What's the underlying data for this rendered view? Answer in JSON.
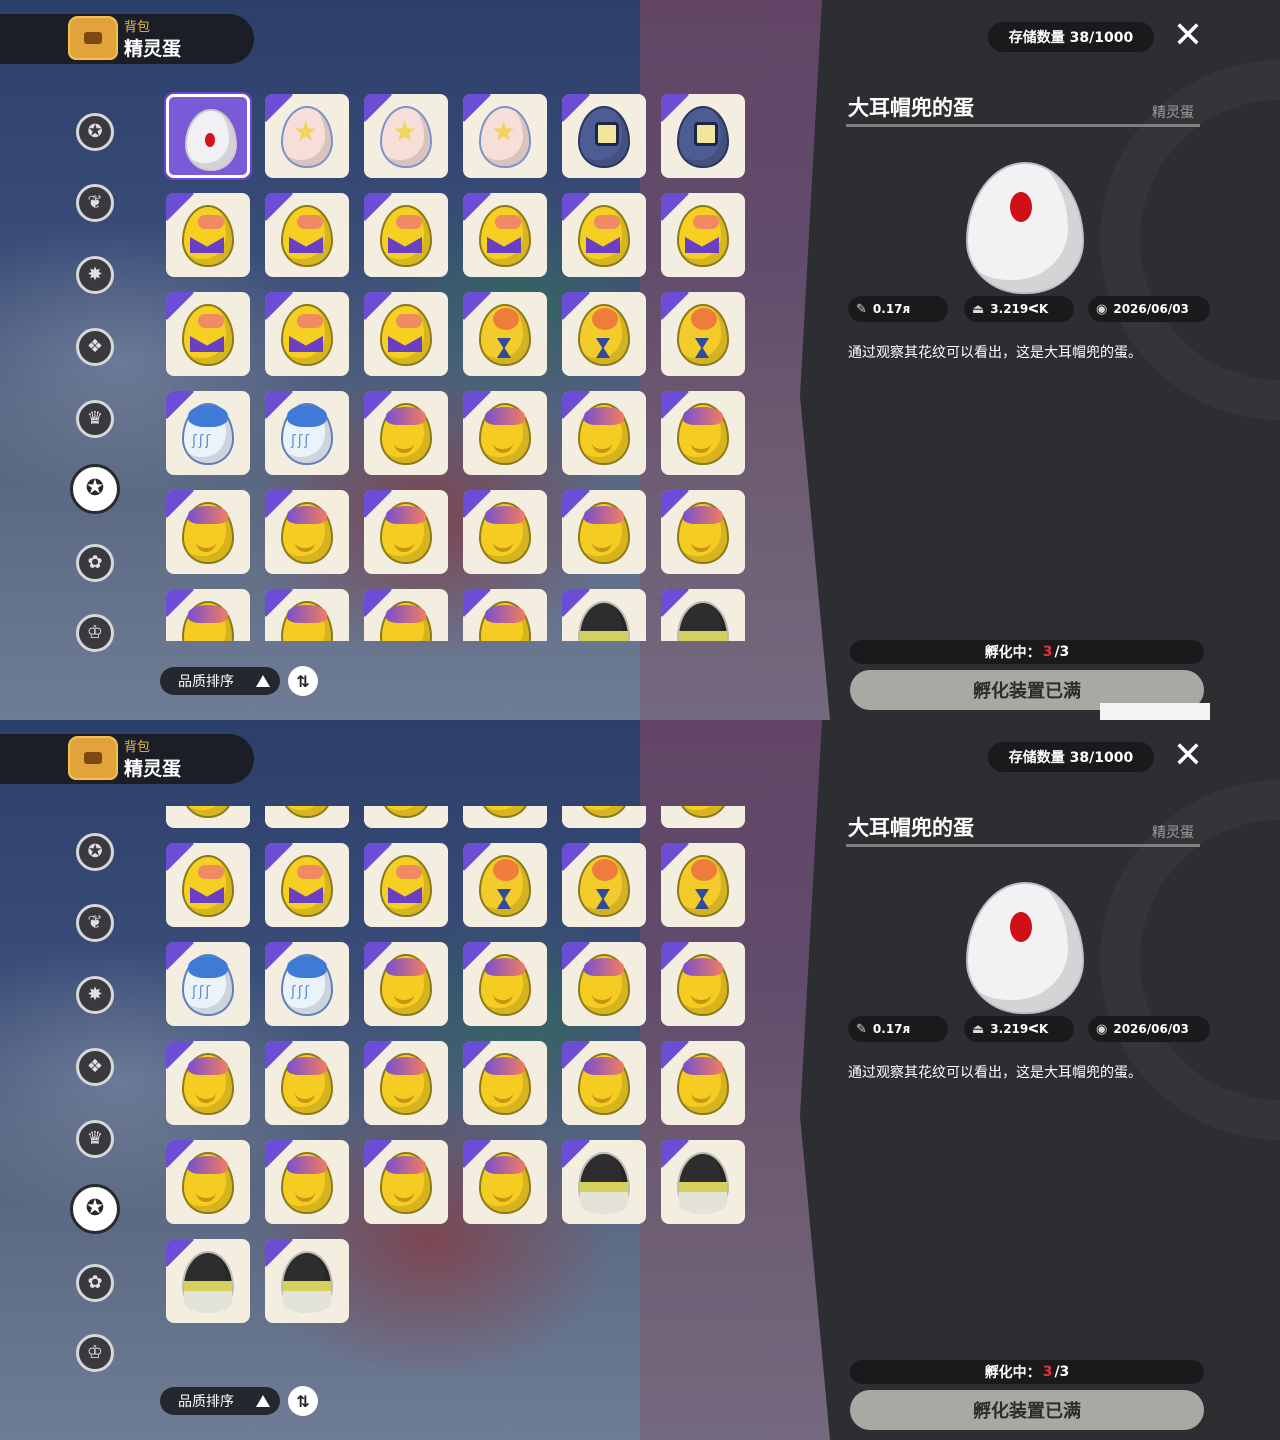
{
  "header": {
    "sub": "背包",
    "title": "精灵蛋"
  },
  "sidebar": {
    "categories": [
      {
        "name": "star-badge",
        "glyph": "✪"
      },
      {
        "name": "leaf",
        "glyph": "❦"
      },
      {
        "name": "sparkle",
        "glyph": "✸"
      },
      {
        "name": "cards",
        "glyph": "❖"
      },
      {
        "name": "map-scroll",
        "glyph": "♛"
      },
      {
        "name": "egg",
        "glyph": "✪",
        "active": true
      },
      {
        "name": "acorn",
        "glyph": "✿"
      },
      {
        "name": "outfit",
        "glyph": "♔"
      }
    ]
  },
  "screens": [
    {
      "eggs": [
        "white",
        "star",
        "star",
        "star",
        "navy",
        "navy",
        "purple",
        "purple",
        "purple",
        "purple",
        "purple",
        "purple",
        "purple",
        "purple",
        "purple",
        "hourglass",
        "hourglass",
        "hourglass",
        "blue",
        "blue",
        "orange",
        "orange",
        "orange",
        "orange",
        "orange",
        "orange",
        "orange",
        "orange",
        "orange",
        "orange",
        "orange",
        "orange",
        "orange",
        "orange",
        "black",
        "black"
      ],
      "selected_index": 0
    },
    {
      "eggs": [
        "purple",
        "purple",
        "purple",
        "purple",
        "purple",
        "purple",
        "purple",
        "purple",
        "purple",
        "hourglass",
        "hourglass",
        "hourglass",
        "blue",
        "blue",
        "orange",
        "orange",
        "orange",
        "orange",
        "orange",
        "orange",
        "orange",
        "orange",
        "orange",
        "orange",
        "orange",
        "orange",
        "orange",
        "orange",
        "black",
        "black",
        "black",
        "black"
      ],
      "selected_index": -1
    }
  ],
  "sort": {
    "label": "品质排序",
    "toggle_glyph": "⇅"
  },
  "storage": "存储数量 38/1000",
  "close_glyph": "✕",
  "item": {
    "name": "大耳帽兜的蛋",
    "category": "精灵蛋",
    "stats": {
      "size": "0.17ᴙ",
      "weight": "3.219ᐸK",
      "date": "2026/06/03"
    },
    "description": "通过观察其花纹可以看出，这是大耳帽兜的蛋。"
  },
  "incubation": {
    "label": "孵化中：",
    "current": "3",
    "total": "/3"
  },
  "incubator_full_label": "孵化装置已满",
  "colors": {
    "accent_purple": "#6c4ed6",
    "egg_red": "#d3121c",
    "panel": "#2d2e32"
  }
}
